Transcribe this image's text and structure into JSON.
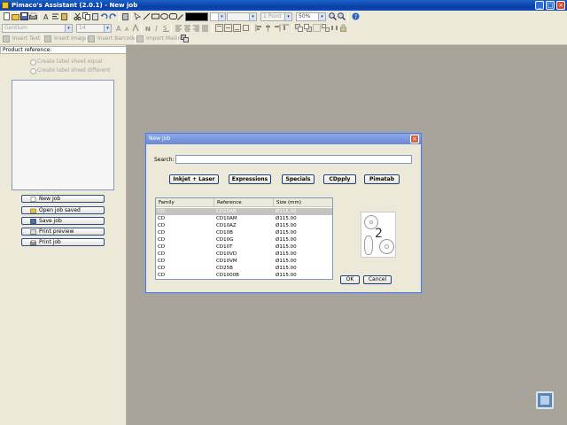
{
  "window": {
    "title": "Pimaco's Assistant (2.0.1)  -  New job"
  },
  "toolbar": {
    "font_name": "Gentium",
    "font_size": "14",
    "line_width": "1 Point",
    "zoom": "50%",
    "color_value": "#000000",
    "insert_text": "Insert Text",
    "insert_image": "Insert Image",
    "insert_barcode": "Insert Barcode",
    "import_mailing": "Import Mailing"
  },
  "left_panel": {
    "product_reference_label": "Product reference:",
    "radio_equal": "Create label sheet equal",
    "radio_different": "Create label sheet different",
    "buttons": {
      "new_job": "New Job",
      "open_job": "Open job saved",
      "save_job": "Save job",
      "print_preview": "Print preview",
      "print_job": "Print job"
    }
  },
  "dialog": {
    "title": "New job",
    "search_label": "Search:",
    "search_value": "",
    "categories": [
      "Inkjet + Laser",
      "Expressions",
      "Specials",
      "CDpply",
      "Pimatab"
    ],
    "table": {
      "columns": [
        "Family",
        "Reference",
        "Size (mm)"
      ],
      "rows": [
        [
          "CD",
          "CD10AB",
          "Ø115.00"
        ],
        [
          "CD",
          "CD10AM",
          "Ø115.00"
        ],
        [
          "CD",
          "CD10AZ",
          "Ø115.00"
        ],
        [
          "CD",
          "CD10B",
          "Ø115.00"
        ],
        [
          "CD",
          "CD10G",
          "Ø115.00"
        ],
        [
          "CD",
          "CD10T",
          "Ø115.00"
        ],
        [
          "CD",
          "CD10VD",
          "Ø115.00"
        ],
        [
          "CD",
          "CD10VM",
          "Ø115.00"
        ],
        [
          "CD",
          "CD25B",
          "Ø115.00"
        ],
        [
          "CD",
          "CD1000B",
          "Ø115.00"
        ]
      ],
      "selected_index": 0
    },
    "preview_count": "2",
    "ok_label": "OK",
    "cancel_label": "Cancel"
  },
  "colors": {
    "titlebar": "#0a3fa6",
    "panel_bg": "#ece9d8",
    "workspace_bg": "#a8a499",
    "dialog_title": "#7b96dc"
  }
}
